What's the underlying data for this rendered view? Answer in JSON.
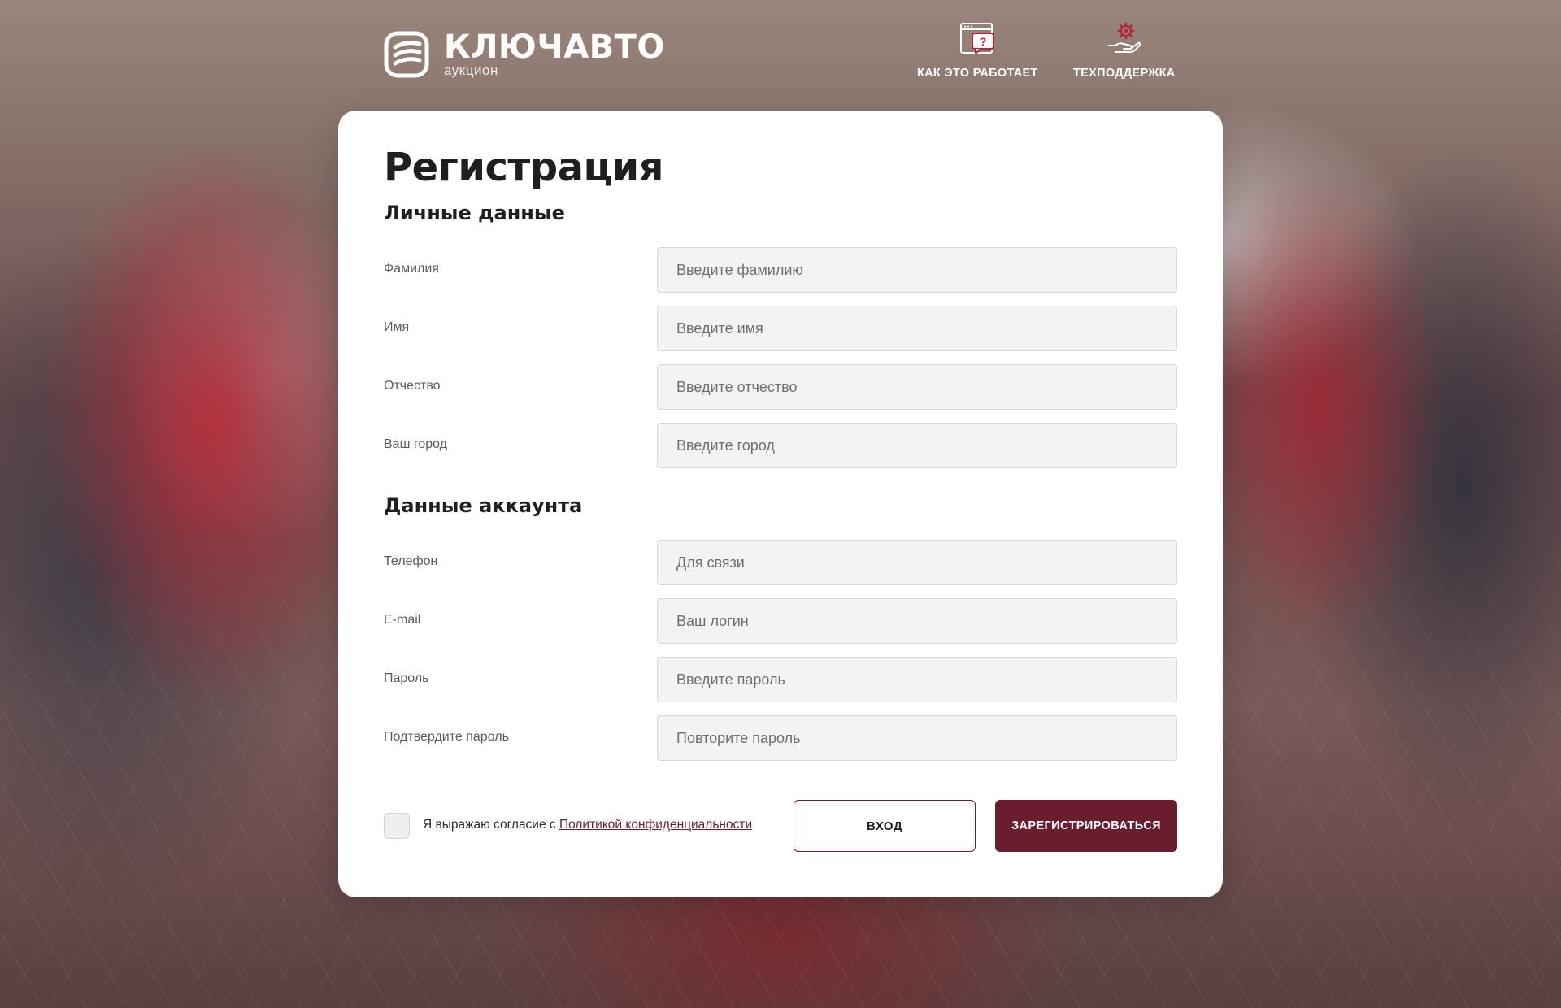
{
  "brand": {
    "name": "КЛЮЧАВТО",
    "subtitle": "аукцион",
    "accent_color": "#6a1d2e",
    "icon_color": "#b8243a"
  },
  "nav": {
    "how_it_works": {
      "label": "КАК ЭТО РАБОТАЕТ",
      "icon": "help-window-icon"
    },
    "support": {
      "label": "ТЕХПОДДЕРЖКА",
      "icon": "gear-hand-icon"
    }
  },
  "form": {
    "title": "Регистрация",
    "personal": {
      "title": "Личные данные",
      "fields": [
        {
          "label": "Фамилия",
          "placeholder": "Введите фамилию",
          "value": ""
        },
        {
          "label": "Имя",
          "placeholder": "Введите имя",
          "value": ""
        },
        {
          "label": "Отчество",
          "placeholder": "Введите отчество",
          "value": ""
        },
        {
          "label": "Ваш город",
          "placeholder": "Введите город",
          "value": ""
        }
      ]
    },
    "account": {
      "title": "Данные аккаунта",
      "fields": [
        {
          "label": "Телефон",
          "placeholder": "Для связи",
          "value": ""
        },
        {
          "label": "E-mail",
          "placeholder": "Ваш логин",
          "value": ""
        },
        {
          "label": "Пароль",
          "placeholder": "Введите пароль",
          "value": ""
        },
        {
          "label": "Подтвердите пароль",
          "placeholder": "Повторите пароль",
          "value": ""
        }
      ]
    },
    "consent": {
      "prefix": "Я выражаю согласие с ",
      "link": "Политикой конфиденциальности",
      "checked": false
    },
    "login_button": "ВХОД",
    "register_button": "ЗАРЕГИСТРИРОВАТЬСЯ"
  }
}
